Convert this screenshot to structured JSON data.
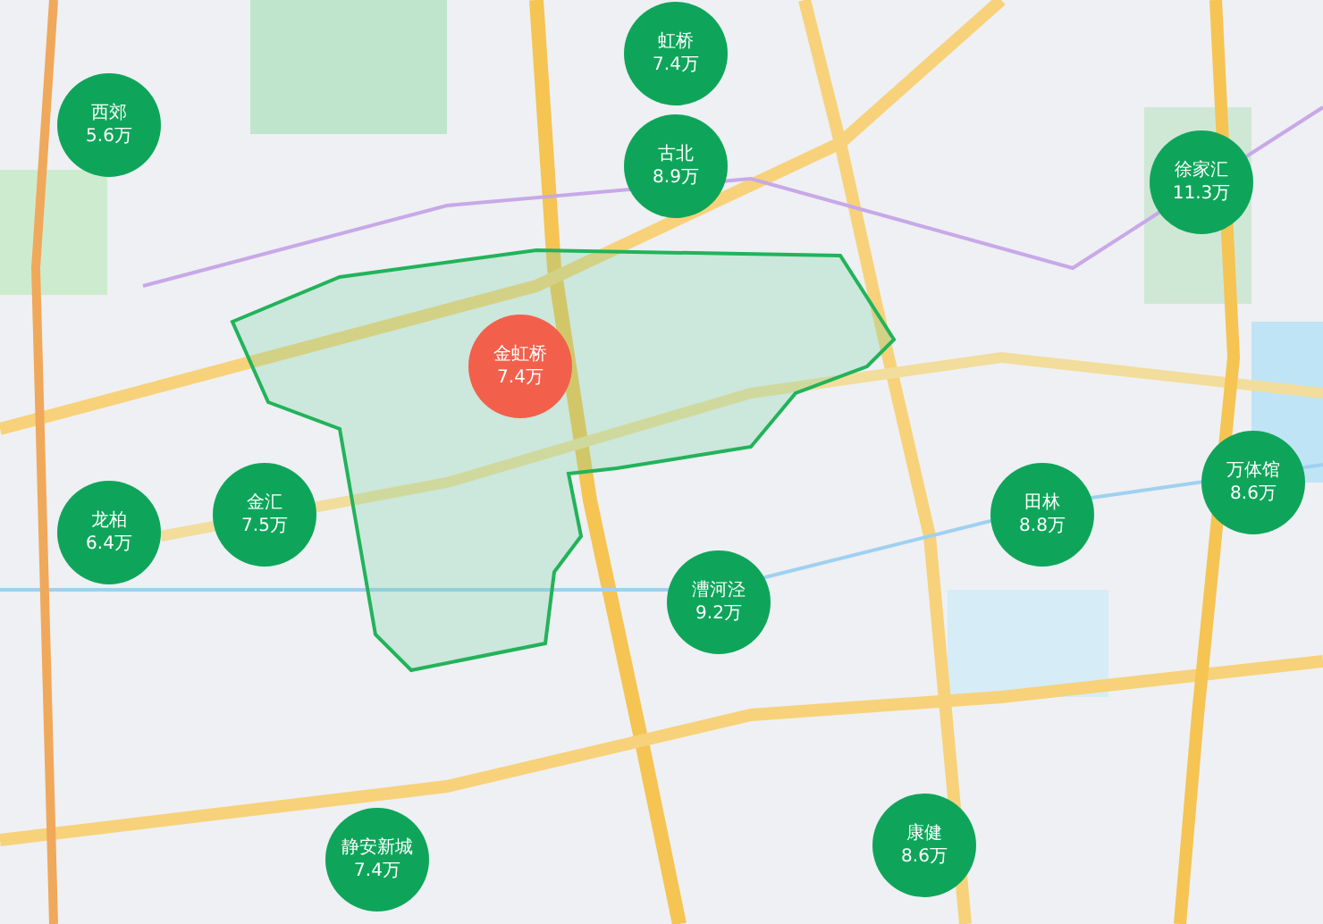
{
  "map": {
    "markers": [
      {
        "name": "西郊",
        "price": "5.6万",
        "selected": false
      },
      {
        "name": "虹桥",
        "price": "7.4万",
        "selected": false
      },
      {
        "name": "古北",
        "price": "8.9万",
        "selected": false
      },
      {
        "name": "徐家汇",
        "price": "11.3万",
        "selected": false
      },
      {
        "name": "金虹桥",
        "price": "7.4万",
        "selected": true
      },
      {
        "name": "金汇",
        "price": "7.5万",
        "selected": false
      },
      {
        "name": "龙柏",
        "price": "6.4万",
        "selected": false
      },
      {
        "name": "田林",
        "price": "8.8万",
        "selected": false
      },
      {
        "name": "万体馆",
        "price": "8.6万",
        "selected": false
      },
      {
        "name": "漕河泾",
        "price": "9.2万",
        "selected": false
      },
      {
        "name": "康健",
        "price": "8.6万",
        "selected": false
      },
      {
        "name": "静安新城",
        "price": "7.4万",
        "selected": false
      }
    ]
  }
}
